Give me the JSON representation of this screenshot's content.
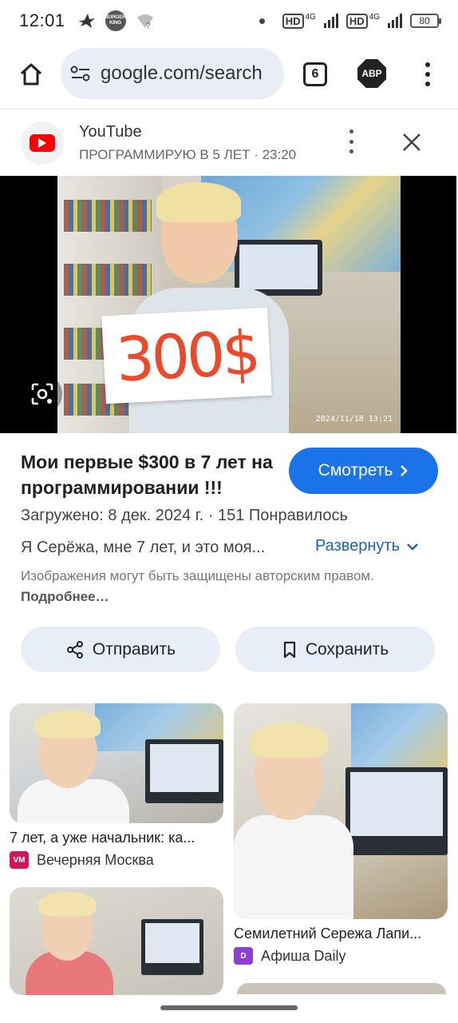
{
  "status_bar": {
    "time": "12:01",
    "burger_logo_text": "BURGER KING",
    "hd1": "HD",
    "net1": "4G",
    "hd2": "HD",
    "net2": "4G",
    "battery": "80"
  },
  "toolbar": {
    "url": "google.com/search",
    "tab_count": "6",
    "adblock_label": "ABP"
  },
  "source": {
    "name": "YouTube",
    "subtitle": "ПРОГРАММИРУЮ В 5 ЛЕТ · 23:20"
  },
  "image": {
    "sign_text": "300$",
    "photo_date": "2024/11/18 13:21"
  },
  "result": {
    "title": "Мои первые $300 в 7 лет на программировании !!!",
    "watch_label": "Смотреть",
    "meta": "Загружено: 8 дек. 2024 г.  ·  151 Понравилось",
    "description": "Я Серёжа, мне 7 лет, и это моя...",
    "expand_label": "Развернуть",
    "copyright_text": "Изображения могут быть защищены авторским правом.",
    "copyright_link": "Подробнее…"
  },
  "actions": {
    "share_label": "Отправить",
    "save_label": "Сохранить"
  },
  "related": [
    {
      "title": "7 лет, а уже начальник: ка...",
      "source": "Вечерняя Москва",
      "logo": "VM",
      "logo_color": "#d4145a"
    },
    {
      "title": "Семилетний Сережа Лапи...",
      "source": "Афиша Daily",
      "logo": "D",
      "logo_color": "#8e3fd6"
    }
  ],
  "colors": {
    "accent": "#1a73e8",
    "link": "#1a62c7",
    "pill_bg": "#e8eef8"
  }
}
